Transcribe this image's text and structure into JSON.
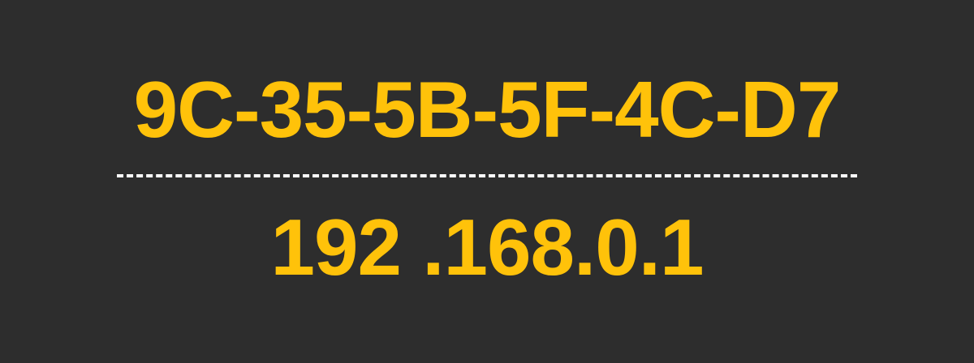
{
  "mac_address": "9C-35-5B-5F-4C-D7",
  "ip_address": "192 .168.0.1",
  "colors": {
    "background": "#2d2d2d",
    "accent": "#ffc20a",
    "divider": "#ffffff"
  }
}
